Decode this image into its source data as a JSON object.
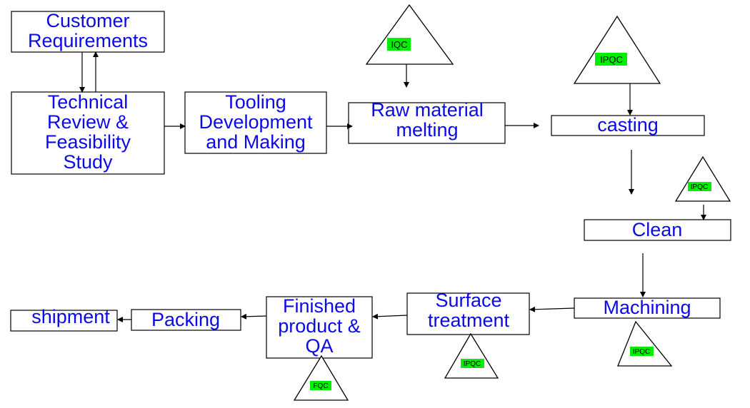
{
  "diagram": {
    "nodes": {
      "customer": [
        "Customer",
        "Requirements"
      ],
      "technical": [
        "Technical",
        "Review &",
        "Feasibility",
        "Study"
      ],
      "tooling": [
        "Tooling",
        "Development",
        "and Making"
      ],
      "raw": [
        "Raw material",
        "melting"
      ],
      "casting": [
        "casting"
      ],
      "clean": [
        "Clean"
      ],
      "machining": [
        "Machining"
      ],
      "surface": [
        "Surface",
        "treatment"
      ],
      "finished": [
        "Finished",
        "product &",
        "QA"
      ],
      "packing": [
        "Packing"
      ],
      "shipment": [
        "shipment"
      ]
    },
    "checkpoints": {
      "raw": "IQC",
      "casting": "IPQC",
      "clean": "IPQC",
      "machining": "IPQC",
      "surface": "IPQC",
      "finished": "FQC"
    },
    "colors": {
      "text": "#0a0ae6",
      "highlight": "#00ee00"
    }
  }
}
